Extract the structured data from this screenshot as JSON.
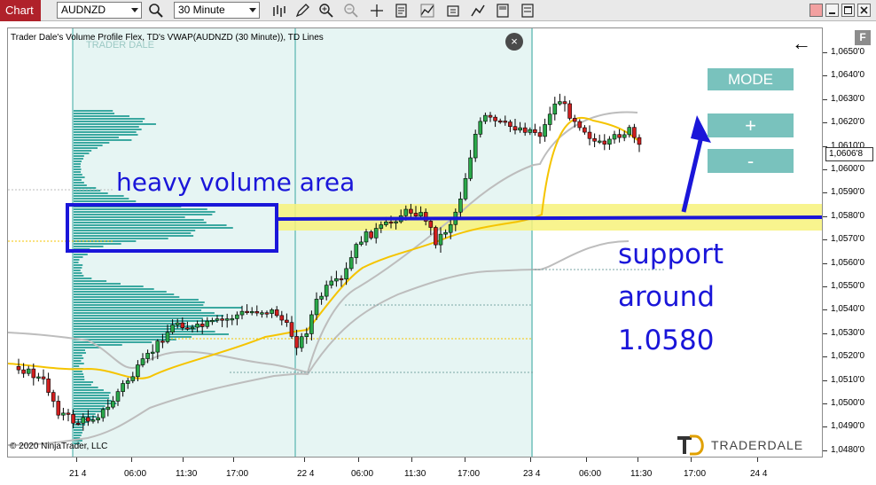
{
  "toolbar": {
    "tab_label": "Chart",
    "instrument": "AUDNZD",
    "timeframe": "30 Minute"
  },
  "chart": {
    "indicator_label": "Trader Dale's Volume Profile Flex, TD's VWAP(AUDNZD (30 Minute)), TD Lines",
    "copyright": "© 2020 NinjaTrader, LLC",
    "watermark": "TRADER DALE",
    "close_symbol": "×",
    "back_symbol": "←",
    "current_price": "1,0606'8",
    "f_label": "F"
  },
  "panel": {
    "mode_label": "MODE",
    "plus_label": "+",
    "minus_label": "-"
  },
  "annotations": {
    "heavy_volume": "heavy volume area",
    "support_line1": "support",
    "support_line2": "around",
    "support_line3": "1.0580"
  },
  "logo": {
    "text": "TRADERDALE",
    "mark": "TD"
  },
  "price_axis": [
    "1,0650'0",
    "1,0640'0",
    "1,0630'0",
    "1,0620'0",
    "1,0610'0",
    "1,0600'0",
    "1,0590'0",
    "1,0580'0",
    "1,0570'0",
    "1,0560'0",
    "1,0550'0",
    "1,0540'0",
    "1,0530'0",
    "1,0520'0",
    "1,0510'0",
    "1,0500'0",
    "1,0490'0",
    "1,0480'0"
  ],
  "time_axis": [
    "21 4",
    "06:00",
    "11:30",
    "17:00",
    "22 4",
    "06:00",
    "11:30",
    "17:00",
    "23 4",
    "06:00",
    "11:30",
    "17:00",
    "24 4"
  ],
  "colors": {
    "candle_up": "#2aa84a",
    "candle_down": "#d01f1f",
    "profile": "#3aa8a0",
    "profile_bg": "#e6f5f3",
    "vwap": "#f5c400",
    "band": "#bdbdbd",
    "support_zone": "#f7f27a",
    "annotation_blue": "#1a16d9",
    "panel_button": "#79c2bd"
  }
}
